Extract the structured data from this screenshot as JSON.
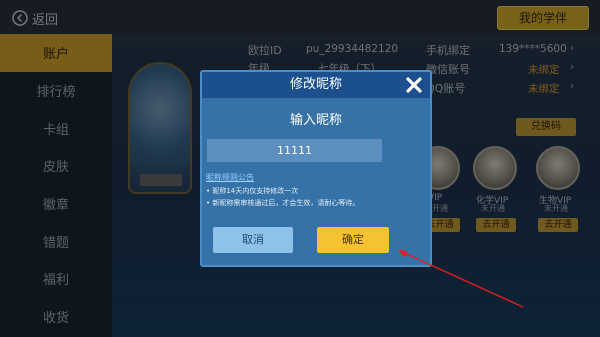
{
  "topbar": {
    "back_label": "返回",
    "students_button": "我的学伴"
  },
  "sidebar": {
    "items": [
      {
        "label": "账户",
        "active": true
      },
      {
        "label": "排行榜"
      },
      {
        "label": "卡组"
      },
      {
        "label": "皮肤"
      },
      {
        "label": "徽章"
      },
      {
        "label": "错题"
      },
      {
        "label": "福利"
      },
      {
        "label": "收货"
      }
    ]
  },
  "account": {
    "id_label": "欧拉ID",
    "id_value": "pu_29934482120",
    "row2_label": "年级",
    "row2_value": "七年级（下）",
    "phone_label": "手机绑定",
    "phone_value": "139****5600",
    "wechat_label": "微信账号",
    "wechat_value": "未绑定",
    "qq_label": "QQ账号",
    "qq_value": "未绑定"
  },
  "redeem_button": "兑换码",
  "vip": [
    {
      "name": "VIP",
      "sub": "未开通",
      "button": "去开通"
    },
    {
      "name": "化学VIP",
      "sub": "未开通",
      "button": "去开通"
    },
    {
      "name": "生物VIP",
      "sub": "未开通",
      "button": "去开通"
    }
  ],
  "dialog": {
    "title": "修改昵称",
    "subtitle": "输入昵称",
    "input_value": "11111",
    "rules_link": "昵称规则公告",
    "notes": [
      "• 昵称14天内仅支持修改一次",
      "• 新昵称需审核通过后，才会生效，请耐心等待。"
    ],
    "cancel": "取消",
    "confirm": "确定"
  },
  "colors": {
    "accent_gold": "#d9a92b",
    "dialog_bg": "#3572a8",
    "dialog_header": "#1b4f8d",
    "annotation_arrow": "#e02020"
  }
}
